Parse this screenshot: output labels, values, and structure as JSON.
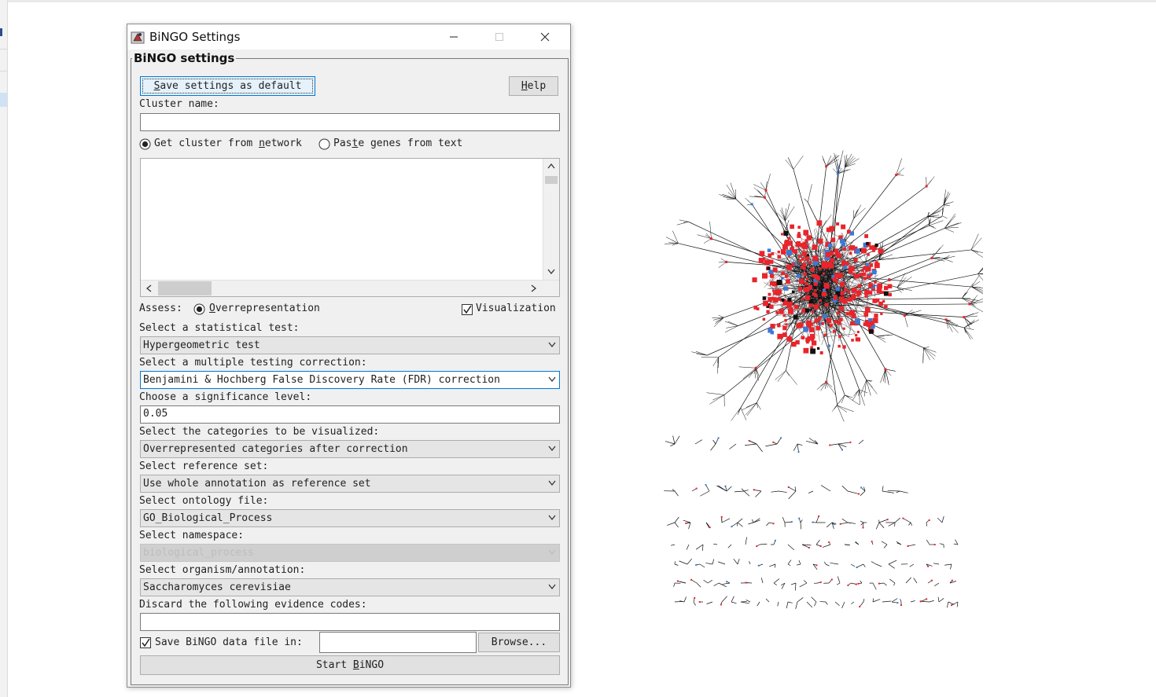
{
  "window": {
    "title": "BiNGO Settings",
    "group_title": "BiNGO settings"
  },
  "buttons": {
    "save_default_pre": "S",
    "save_default_post": "ave settings as default",
    "help_pre": "H",
    "help_post": "elp",
    "browse": "Browse...",
    "start_pre": "Start ",
    "start_u": "B",
    "start_post": "iNGO"
  },
  "cluster": {
    "label": "Cluster name:",
    "value": "",
    "radio_network_pre": "Get cluster from ",
    "radio_network_u": "n",
    "radio_network_post": "etwork",
    "radio_paste_pre": "Pas",
    "radio_paste_u": "t",
    "radio_paste_post": "e genes from text",
    "network_selected": true
  },
  "assess": {
    "label": "Assess:",
    "option_u": "O",
    "option_post": "verrepresentation",
    "visualization_label": "Visualization",
    "visualization_checked": true
  },
  "fields": {
    "stat_test_label": "Select a statistical test:",
    "stat_test_value": "Hypergeometric test",
    "correction_label": "Select a multiple testing correction:",
    "correction_value": "Benjamini & Hochberg False Discovery Rate (FDR) correction",
    "significance_label": "Choose a significance level:",
    "significance_value": "0.05",
    "categories_label": "Select the categories to be visualized:",
    "categories_value": "Overrepresented categories after correction",
    "reference_label": "Select reference set:",
    "reference_value": "Use whole annotation as reference set",
    "ontology_label": "Select ontology file:",
    "ontology_value": "GO_Biological_Process",
    "namespace_label": "Select namespace:",
    "namespace_value": "biological_process",
    "organism_label": "Select organism/annotation:",
    "organism_value": "Saccharomyces cerevisiae",
    "evidence_label": "Discard the following evidence codes:",
    "evidence_value": "",
    "save_data_label": "Save BiNGO data file in:",
    "save_data_checked": true,
    "save_data_path": ""
  },
  "colors": {
    "node_red": "#e8242c",
    "node_blue": "#3a7bd5",
    "edge": "#111111"
  }
}
